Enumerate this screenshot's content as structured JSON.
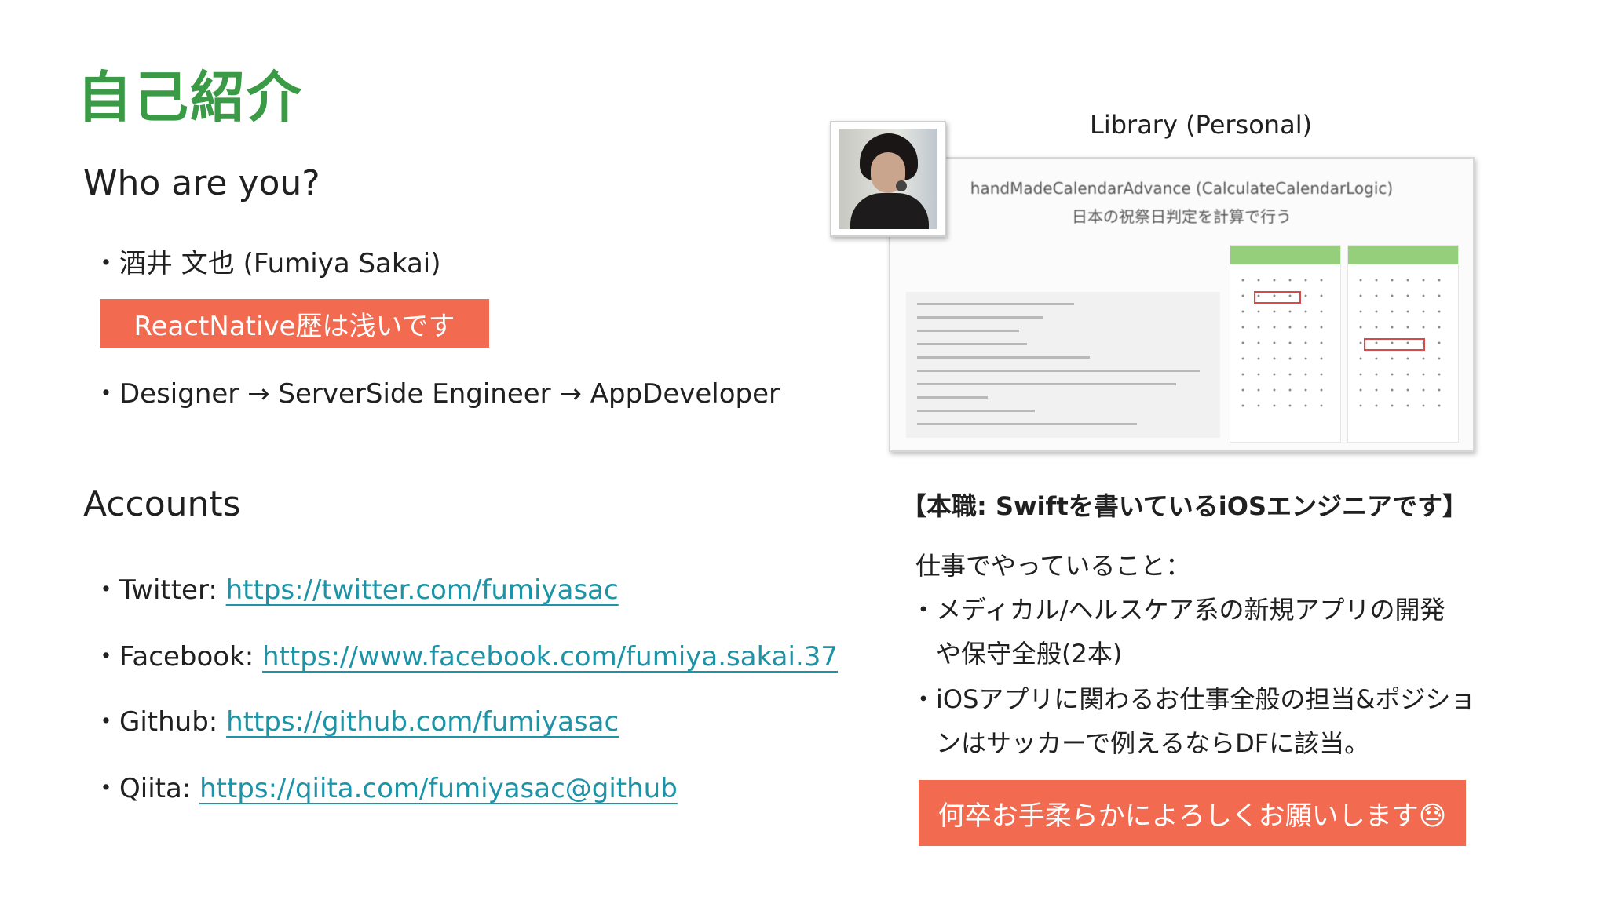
{
  "title": "自己紹介",
  "who": {
    "heading": "Who are you?",
    "name_line": "・酒井 文也 (Fumiya Sakai)",
    "badge": "ReactNative歴は浅いです",
    "career_line": "・Designer → ServerSide Engineer  → AppDeveloper"
  },
  "accounts": {
    "heading": "Accounts",
    "items": [
      {
        "label": "・Twitter: ",
        "url": "https://twitter.com/fumiyasac"
      },
      {
        "label": "・Facebook: ",
        "url": "https://www.facebook.com/fumiya.sakai.37"
      },
      {
        "label": "・Github: ",
        "url": "https://github.com/fumiyasac"
      },
      {
        "label": "・Qiita: ",
        "url": "https://qiita.com/fumiyasac@github"
      }
    ]
  },
  "library": {
    "label": "Library (Personal)",
    "shot_title": "handMadeCalendarAdvance (CalculateCalendarLogic)",
    "shot_subtitle": "日本の祝祭日判定を計算で行う"
  },
  "job": {
    "title": "【本職: Swiftを書いているiOSエンジニアです】",
    "intro": "仕事でやっていること：",
    "bullets": [
      [
        "・メディカル/ヘルスケア系の新規アプリの開発",
        "　や保守全般(2本)"
      ],
      [
        "・iOSアプリに関わるお仕事全般の担当&ポジショ",
        "　ンはサッカーで例えるならDFに該当。"
      ]
    ],
    "badge": "何卒お手柔らかによろしくお願いします😓"
  },
  "colors": {
    "title_green": "#3a9a46",
    "badge_orange": "#f26a4f",
    "link_teal": "#1c93a6",
    "calendar_header_green": "#95cf7c"
  }
}
